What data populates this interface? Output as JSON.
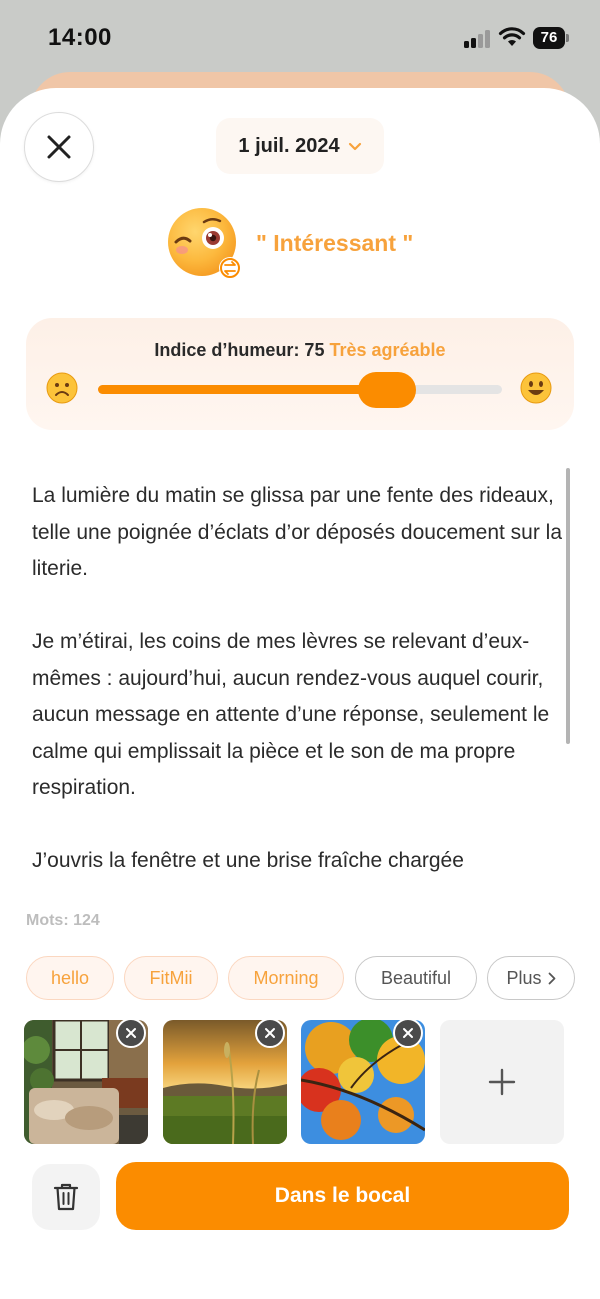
{
  "status_bar": {
    "time": "14:00",
    "battery": "76"
  },
  "header": {
    "date": "1 juil. 2024"
  },
  "mood": {
    "label": "\" Intéressant \"",
    "index_prefix": "Indice d’humeur: 75",
    "index_label": "Très agréable",
    "index_value": 75
  },
  "journal": {
    "paragraphs": [
      "La lumière du matin se glissa par une fente des rideaux, telle une poignée d’éclats d’or déposés doucement sur la literie.",
      "Je m’étirai, les coins de mes lèvres se relevant d’eux-mêmes : aujourd’hui, aucun rendez-vous auquel courir, aucun message en attente d’une réponse, seulement le calme qui emplissait la pièce et le son de ma propre respiration.",
      "J’ouvris la fenêtre et une brise fraîche chargée"
    ]
  },
  "word_count": "Mots: 124",
  "tags": [
    "hello",
    "FitMii",
    "Morning",
    "Beautiful"
  ],
  "tags_more": "Plus",
  "actions": {
    "submit": "Dans le bocal"
  },
  "colors": {
    "accent": "#fb8c00",
    "accent_text": "#f7a23c"
  }
}
